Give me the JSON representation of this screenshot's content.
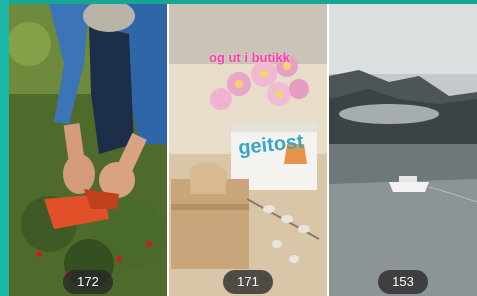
{
  "tiles": [
    {
      "count": "172",
      "label": "berry-picking-photo"
    },
    {
      "count": "171",
      "label": "gift-and-cheese-photo",
      "overlay_text": "og ut i butikk",
      "brand_text": "geitost"
    },
    {
      "count": "153",
      "label": "fjord-boat-photo"
    }
  ]
}
